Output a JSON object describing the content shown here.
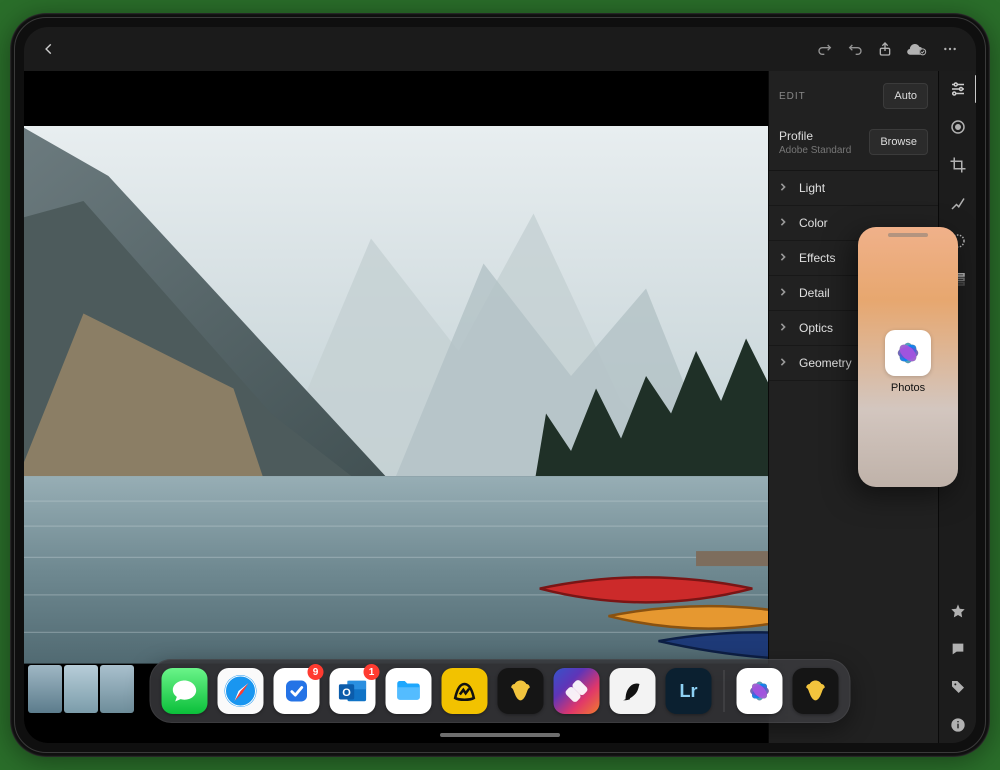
{
  "topbar": {
    "back_icon": "back",
    "icons": [
      "redo",
      "undo",
      "share",
      "cloud-check",
      "more"
    ]
  },
  "edit": {
    "header_label": "EDIT",
    "auto_label": "Auto",
    "profile_label": "Profile",
    "profile_value": "Adobe Standard",
    "browse_label": "Browse",
    "panels": [
      "Light",
      "Color",
      "Effects",
      "Detail",
      "Optics",
      "Geometry"
    ]
  },
  "toolstrip": {
    "top_tools": [
      "sliders",
      "circle",
      "crop",
      "brush",
      "radial",
      "gradient"
    ],
    "bottom_tools": [
      "star",
      "comment",
      "tag",
      "info"
    ]
  },
  "slideover": {
    "app_label": "Photos"
  },
  "dock": {
    "apps": [
      {
        "name": "messages",
        "color": "#35d15a",
        "glyph": "💬",
        "badge": null
      },
      {
        "name": "safari",
        "color": "#f7f7f7",
        "glyph": "🧭",
        "badge": null
      },
      {
        "name": "things",
        "color": "#ffffff",
        "glyph": "✔",
        "badge": "9"
      },
      {
        "name": "outlook",
        "color": "#1073c6",
        "glyph": "O",
        "badge": "1"
      },
      {
        "name": "files",
        "color": "#ffffff",
        "glyph": "📁",
        "badge": null
      },
      {
        "name": "basecamp",
        "color": "#f2c200",
        "glyph": "◎",
        "badge": null
      },
      {
        "name": "bear",
        "color": "#1a1a1a",
        "glyph": "🦋",
        "badge": null
      },
      {
        "name": "shortcuts",
        "color": "#3346a0",
        "glyph": "▦",
        "badge": null
      },
      {
        "name": "drafts",
        "color": "#f3f3f3",
        "glyph": "🐴",
        "badge": null
      },
      {
        "name": "lightroom",
        "color": "#0f2233",
        "glyph": "Lr",
        "badge": null
      }
    ],
    "recent": [
      {
        "name": "photos",
        "color": "#ffffff",
        "glyph": "✿",
        "badge": null
      },
      {
        "name": "bear2",
        "color": "#1a1a1a",
        "glyph": "🦋",
        "badge": null
      }
    ]
  }
}
